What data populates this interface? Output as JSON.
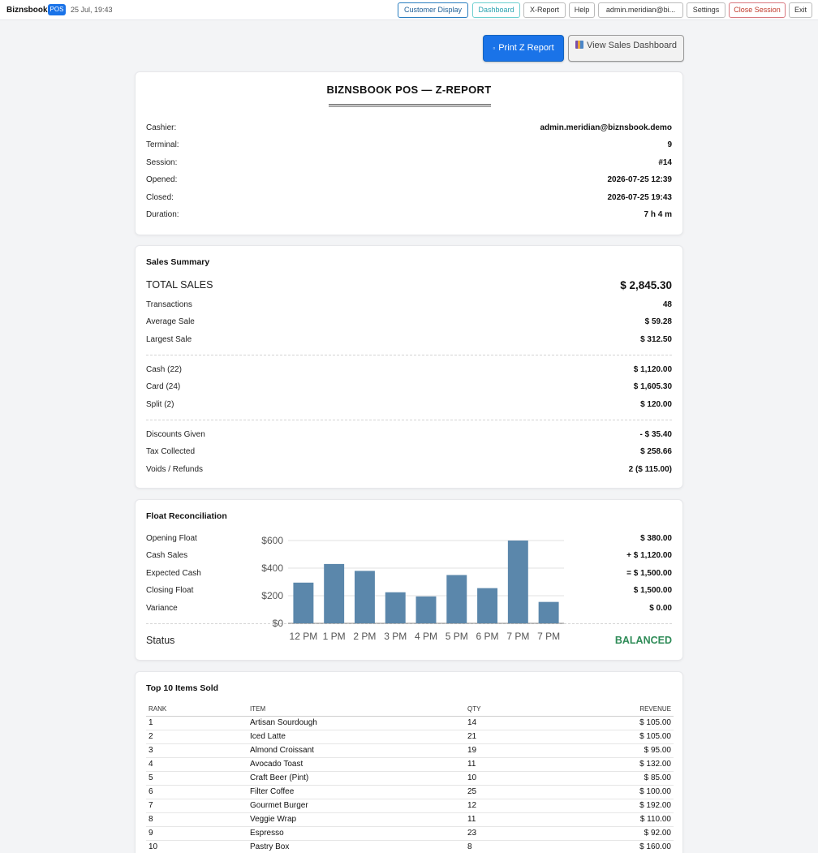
{
  "topbar": {
    "brand": "Biznsbook",
    "badge": "POS",
    "datetime": "25 Jul, 19:43",
    "buttons": {
      "customer_display": "Customer Display",
      "dashboard": "Dashboard",
      "x_report": "X-Report",
      "help": "Help",
      "user": "admin.meridian@bi...",
      "settings": "Settings",
      "close_session": "Close Session",
      "exit": "Exit"
    }
  },
  "actions": {
    "print_icon": "printer-icon",
    "print_label": "Print Z Report",
    "dashboard_icon": "bar-chart-icon",
    "dashboard_label": "View Sales Dashboard"
  },
  "report": {
    "title": "BIZNSBOOK POS — Z-REPORT",
    "info": [
      {
        "label": "Cashier:",
        "value": "admin.meridian@biznsbook.demo"
      },
      {
        "label": "Terminal:",
        "value": "9"
      },
      {
        "label": "Session:",
        "value": "#14"
      },
      {
        "label": "Opened:",
        "value": "2026-07-25 12:39"
      },
      {
        "label": "Closed:",
        "value": "2026-07-25 19:43"
      },
      {
        "label": "Duration:",
        "value": "7 h 4 m"
      }
    ]
  },
  "sales": {
    "title": "Sales Summary",
    "total_label": "TOTAL SALES",
    "total_value": "$ 2,845.30",
    "group1": [
      {
        "label": "Transactions",
        "value": "48"
      },
      {
        "label": "Average Sale",
        "value": "$ 59.28"
      },
      {
        "label": "Largest Sale",
        "value": "$ 312.50"
      }
    ],
    "group2": [
      {
        "label": "Cash (22)",
        "value": "$ 1,120.00"
      },
      {
        "label": "Card (24)",
        "value": "$ 1,605.30"
      },
      {
        "label": "Split (2)",
        "value": "$ 120.00"
      }
    ],
    "group3": [
      {
        "label": "Discounts Given",
        "value": "- $ 35.40"
      },
      {
        "label": "Tax Collected",
        "value": "$ 258.66"
      },
      {
        "label": "Voids / Refunds",
        "value": "2 ($ 115.00)"
      }
    ]
  },
  "float": {
    "title": "Float Reconciliation",
    "rows": [
      {
        "label": "Opening Float",
        "value": "$ 380.00"
      },
      {
        "label": "Cash Sales",
        "value": "+ $ 1,120.00"
      },
      {
        "label": "Expected Cash",
        "value": "= $ 1,500.00"
      },
      {
        "label": "Closing Float",
        "value": "$ 1,500.00"
      },
      {
        "label": "Variance",
        "value": "$ 0.00"
      }
    ],
    "status_label": "Status",
    "status_value": "BALANCED",
    "status_color": "#2e8b57"
  },
  "chart_data": {
    "type": "bar",
    "categories": [
      "12 PM",
      "1 PM",
      "2 PM",
      "3 PM",
      "4 PM",
      "5 PM",
      "6 PM",
      "7 PM",
      "7 PM"
    ],
    "values": [
      295,
      430,
      380,
      225,
      195,
      350,
      255,
      600,
      155
    ],
    "yticks": [
      "$0",
      "$200",
      "$400",
      "$600"
    ],
    "ylim": [
      0,
      600
    ],
    "grid": true,
    "bar_color": "#5b87ab"
  },
  "top_items": {
    "title": "Top 10 Items Sold",
    "headers": {
      "rank": "RANK",
      "item": "ITEM",
      "qty": "QTY",
      "revenue": "REVENUE"
    },
    "rows": [
      {
        "rank": "1",
        "item": "Artisan Sourdough",
        "qty": "14",
        "revenue": "$ 105.00"
      },
      {
        "rank": "2",
        "item": "Iced Latte",
        "qty": "21",
        "revenue": "$ 105.00"
      },
      {
        "rank": "3",
        "item": "Almond Croissant",
        "qty": "19",
        "revenue": "$ 95.00"
      },
      {
        "rank": "4",
        "item": "Avocado Toast",
        "qty": "11",
        "revenue": "$ 132.00"
      },
      {
        "rank": "5",
        "item": "Craft Beer (Pint)",
        "qty": "10",
        "revenue": "$ 85.00"
      },
      {
        "rank": "6",
        "item": "Filter Coffee",
        "qty": "25",
        "revenue": "$ 100.00"
      },
      {
        "rank": "7",
        "item": "Gourmet Burger",
        "qty": "12",
        "revenue": "$ 192.00"
      },
      {
        "rank": "8",
        "item": "Veggie Wrap",
        "qty": "11",
        "revenue": "$ 110.00"
      },
      {
        "rank": "9",
        "item": "Espresso",
        "qty": "23",
        "revenue": "$ 92.00"
      },
      {
        "rank": "10",
        "item": "Pastry Box",
        "qty": "8",
        "revenue": "$ 160.00"
      }
    ]
  }
}
